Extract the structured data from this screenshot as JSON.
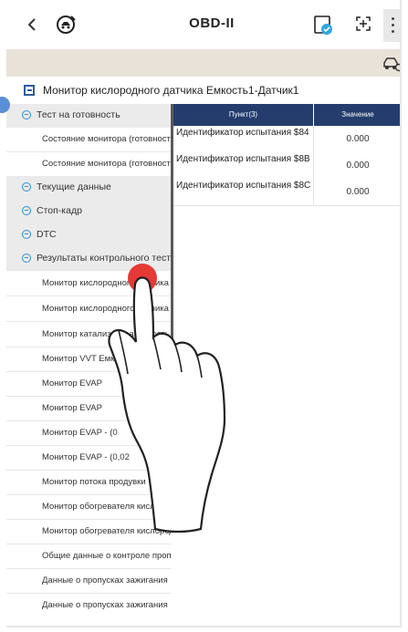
{
  "topbar": {
    "title": "OBD-II",
    "back_icon": "chevron-left-icon",
    "logo_icon": "car-diagnostic-logo-icon",
    "icon1": "report-icon",
    "icon2": "add-screenshot-icon",
    "menu_icon": "more-vert-icon"
  },
  "subbar": {
    "icon": "car-settings-icon",
    "color": "#e9e2d9"
  },
  "path": {
    "icon": "collapse-panel-icon",
    "text": "Монитор кислородного датчика Емкость1-Датчик1"
  },
  "sidebar": {
    "items": [
      {
        "type": "cat",
        "label": "Тест на готовность"
      },
      {
        "type": "sub",
        "label": "Состояние монитора (готовность)"
      },
      {
        "type": "sub",
        "label": "Состояние монитора (готовность)"
      },
      {
        "type": "cat",
        "label": "Текущие данные"
      },
      {
        "type": "cat",
        "label": "Стоп-кадр"
      },
      {
        "type": "cat",
        "label": "DTC"
      },
      {
        "type": "cat",
        "label": "Результаты контрольного теста"
      },
      {
        "type": "sub",
        "label": "Монитор кислородного датчика"
      },
      {
        "type": "sub",
        "label": "Монитор кислородного датчика"
      },
      {
        "type": "sub",
        "label": "Монитор катализатора Емкость"
      },
      {
        "type": "sub",
        "label": "Монитор VVT Емкость"
      },
      {
        "type": "sub",
        "label": "Монитор EVAP"
      },
      {
        "type": "sub",
        "label": "Монитор EVAP"
      },
      {
        "type": "sub",
        "label": "Монитор EVAP - (0"
      },
      {
        "type": "sub",
        "label": "Монитор EVAP - (0,02"
      },
      {
        "type": "sub",
        "label": "Монитор потока продувки"
      },
      {
        "type": "sub",
        "label": "Монитор обогревателя кислородного"
      },
      {
        "type": "sub",
        "label": "Монитор обогревателя кислородного"
      },
      {
        "type": "sub",
        "label": "Общие данные о контроле пропусков"
      },
      {
        "type": "sub",
        "label": "Данные о пропусках зажигания"
      },
      {
        "type": "sub",
        "label": "Данные о пропусках зажигания"
      }
    ]
  },
  "table": {
    "headers": [
      "Пункт(3)",
      "Значение"
    ],
    "rows": [
      {
        "item": "Идентификатор испытания $84",
        "value": "0.000"
      },
      {
        "item": "Идентификатор испытания $8B",
        "value": "0.000"
      },
      {
        "item": "Идентификатор испытания $8C",
        "value": "0.000"
      }
    ],
    "header_color": "#243d6d"
  },
  "overlay": {
    "touch_icon": "touch-point-icon",
    "hand_icon": "pointing-hand-icon",
    "touch_color": "#e53935"
  }
}
